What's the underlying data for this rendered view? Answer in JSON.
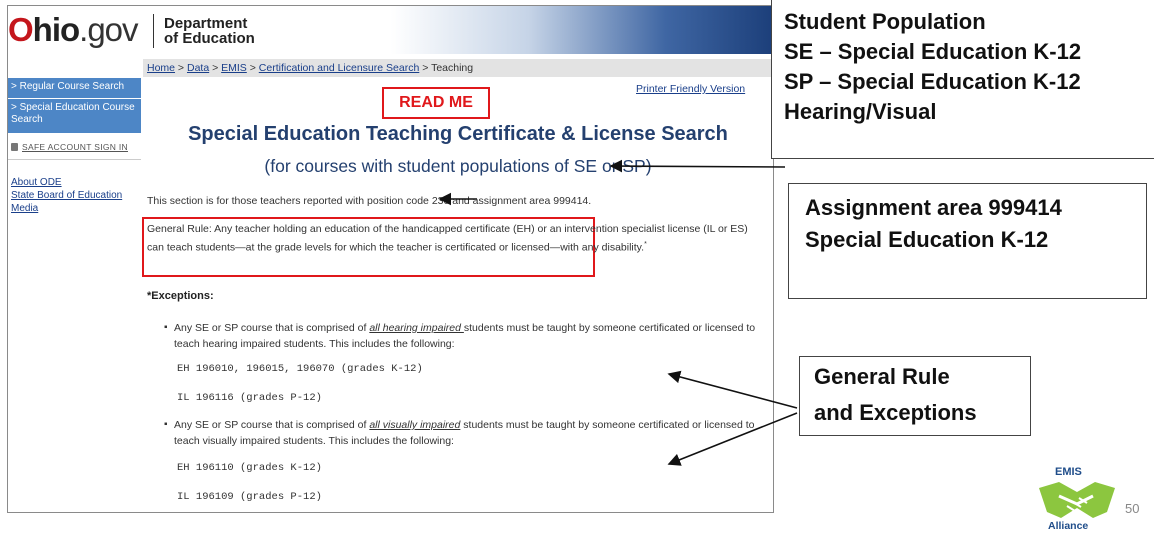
{
  "header": {
    "logo_o": "O",
    "logo_hio": "hio",
    "logo_gov": ".gov",
    "dept_line1": "Department",
    "dept_line2": "of Education"
  },
  "breadcrumb": {
    "home": "Home",
    "sep1": " > ",
    "data": "Data",
    "sep2": " > ",
    "emis": "EMIS",
    "sep3": " > ",
    "cert": "Certification and Licensure Search",
    "sep4": " > ",
    "current": "Teaching"
  },
  "sidebar": {
    "regular": "> Regular Course Search",
    "special": "> Special Education Course Search",
    "safe": "SAFE ACCOUNT SIGN IN",
    "about": "About ODE",
    "board": "State Board of Education",
    "media": "Media"
  },
  "main": {
    "printer": "Printer Friendly Version",
    "readme": "READ ME",
    "title": "Special Education Teaching Certificate & License Search",
    "subtitle": "(for courses with student populations of SE or SP)",
    "section_text": "This section is for those teachers reported with position code 230 and assignment area 999414.",
    "general_rule": "General Rule: Any teacher holding an education of the handicapped certificate (EH) or an intervention specialist license (IL or ES) can teach students—at the grade levels for which the teacher is certificated or licensed—with any disability.",
    "general_rule_mark": "*",
    "exceptions_heading": "*Exceptions:",
    "exc1_pre": "Any SE or SP course that is comprised of ",
    "exc1_em": "all hearing impaired ",
    "exc1_post": "students must be taught by someone certificated or licensed to teach hearing impaired students. This includes the following:",
    "code1": "EH 196010, 196015, 196070 (grades K-12)",
    "code2": "IL 196116 (grades P-12)",
    "exc2_pre": "Any SE or SP course that is comprised of ",
    "exc2_em": "all visually impaired",
    "exc2_post": " students must be taught by someone certificated or licensed to teach visually impaired students. This includes the following:",
    "code3": "EH 196110 (grades K-12)",
    "code4": "IL 196109 (grades P-12)"
  },
  "callouts": {
    "pop_l1": "Student Population",
    "pop_l2": "SE – Special Education K-12",
    "pop_l3": "SP – Special Education K-12",
    "pop_l4": "Hearing/Visual",
    "area_l1": "Assignment area 999414",
    "area_l2": "Special Education K-12",
    "rule_l1": "General Rule",
    "rule_l2": "and Exceptions"
  },
  "footer": {
    "emis": "EMIS",
    "alliance": "Alliance",
    "page": "50"
  },
  "colors": {
    "accent_red": "#e0181b",
    "link_blue": "#1a3f8a",
    "title_blue": "#24406f",
    "sidebar_blue": "#4d86c6"
  }
}
